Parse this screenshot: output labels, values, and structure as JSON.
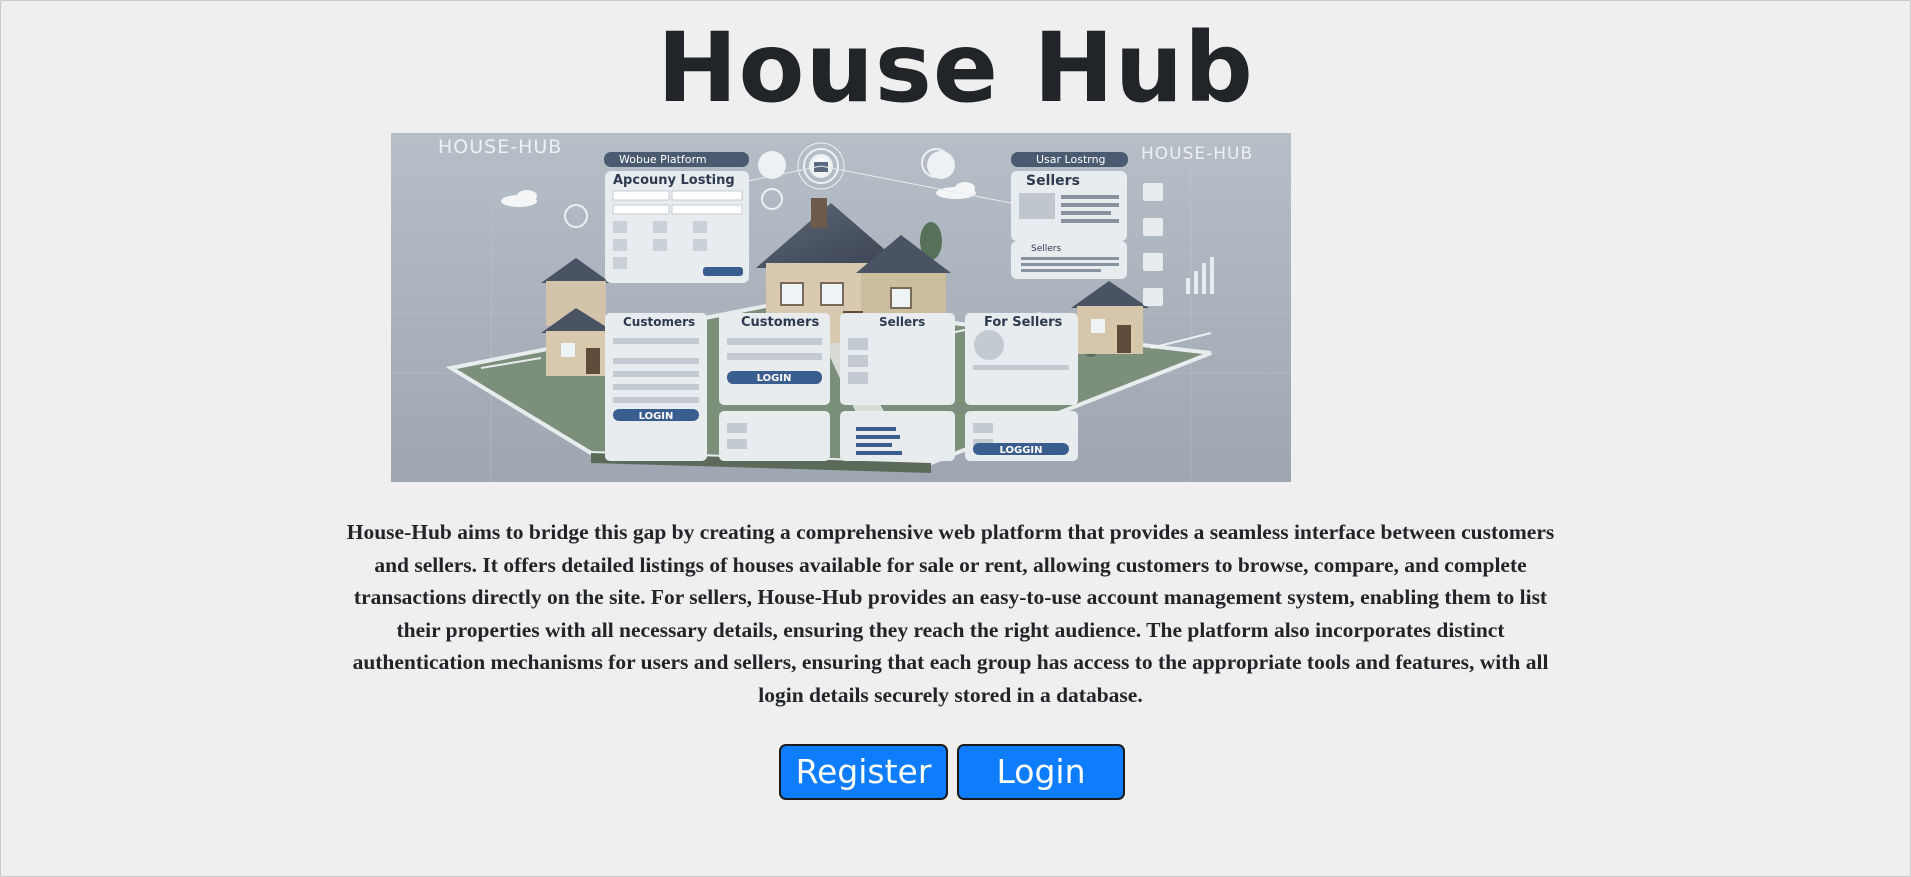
{
  "page": {
    "title": "House Hub"
  },
  "hero": {
    "alt": "House-Hub platform illustration",
    "brand_left": "HOUSE-HUB",
    "brand_right": "HOUSE-HUB",
    "tag_left": "Wobue Platform",
    "tag_right": "Usar Lostrng",
    "card_account": "Apcouny Losting",
    "card_sellers_top": "Sellers",
    "card_sellers_small": "Sellers",
    "card_customers_1": "Customers",
    "card_customers_2": "Customers",
    "card_sellers_mid": "Sellers",
    "card_for_sellers": "For Sellers",
    "login_1": "LOGIN",
    "login_2": "LOGIN",
    "login_3": "LOGGIN",
    "colors": {
      "background": "#aab3bd",
      "card": "#e9ecef",
      "accent": "#3a5d8f"
    }
  },
  "description": "House-Hub aims to bridge this gap by creating a comprehensive web platform that provides a seamless interface between customers and sellers. It offers detailed listings of houses available for sale or rent, allowing customers to browse, compare, and complete transactions directly on the site. For sellers, House-Hub provides an easy-to-use account management system, enabling them to list their properties with all necessary details, ensuring they reach the right audience. The platform also incorporates distinct authentication mechanisms for users and sellers, ensuring that each group has access to the appropriate tools and features, with all login details securely stored in a database.",
  "actions": {
    "register_label": "Register",
    "login_label": "Login",
    "button_color": "#0d7dfd"
  }
}
